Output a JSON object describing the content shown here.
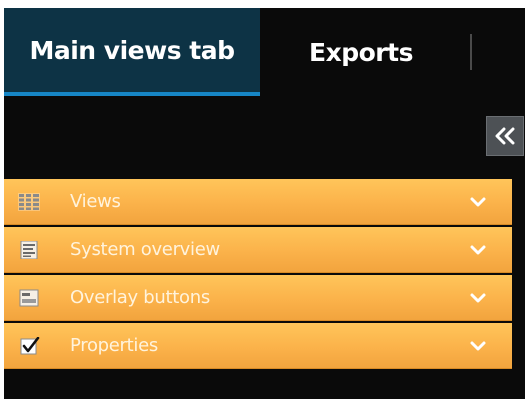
{
  "tabs": [
    {
      "label": "Main views tab",
      "active": true
    },
    {
      "label": "Exports",
      "active": false
    }
  ],
  "collapse_button": {
    "icon": "double-chevron-left-icon"
  },
  "panels": [
    {
      "label": "Views",
      "icon": "grid-icon"
    },
    {
      "label": "System overview",
      "icon": "document-list-icon"
    },
    {
      "label": "Overlay buttons",
      "icon": "overlay-buttons-icon"
    },
    {
      "label": "Properties",
      "icon": "checkbox-checked-icon"
    }
  ],
  "colors": {
    "background": "#0a0a0a",
    "active_tab": "#0d3345",
    "active_tab_underline": "#1686c6",
    "panel_orange": "#fbb24a",
    "collapse_button": "#4d5155"
  }
}
